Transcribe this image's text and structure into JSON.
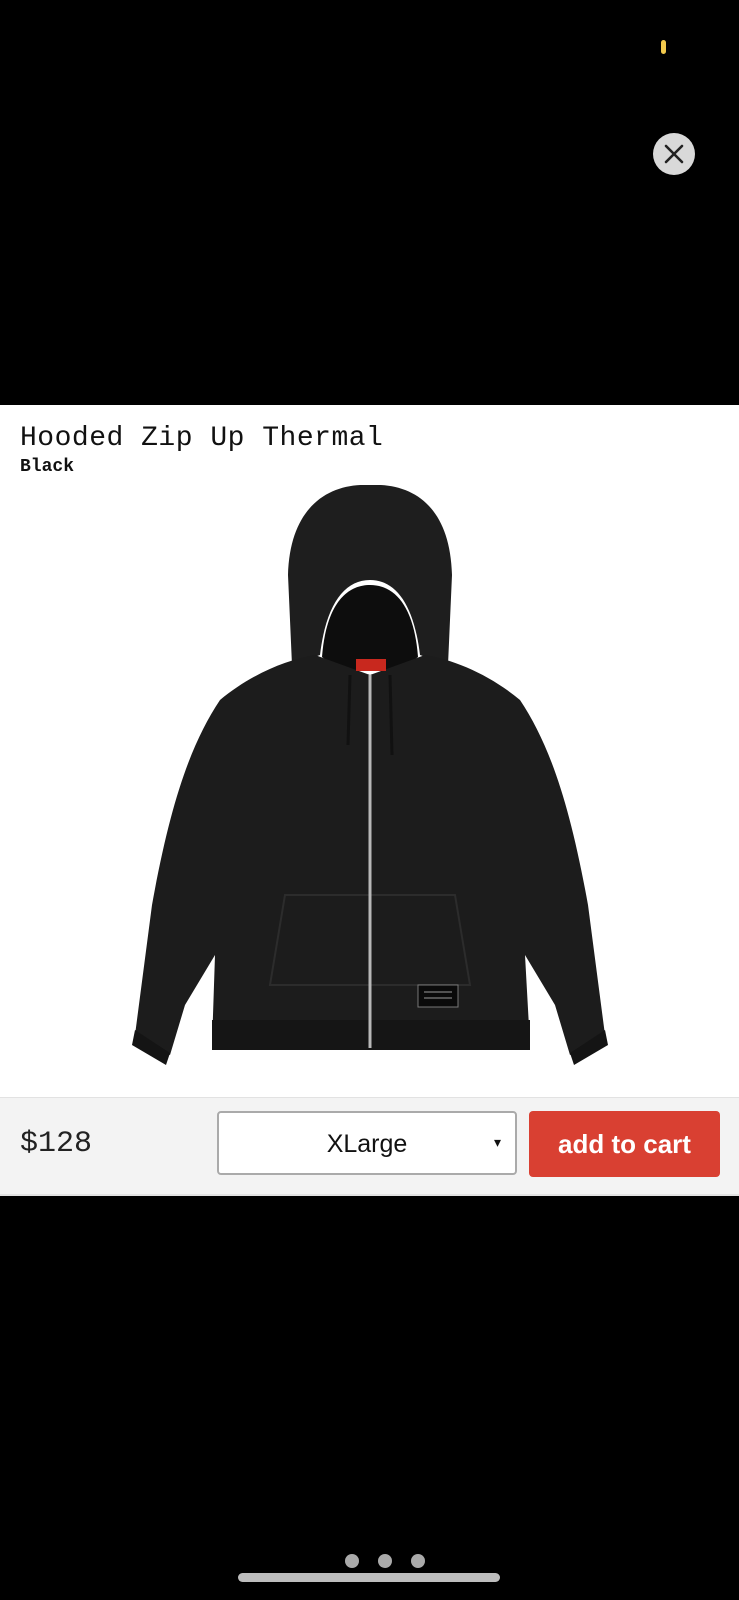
{
  "status": {
    "indicator_color": "#f2c94c"
  },
  "modal": {
    "close_icon": "close-icon"
  },
  "product": {
    "title": "Hooded Zip Up Thermal",
    "color": "Black",
    "image_description_icon": "hoodie-image",
    "price": "$128"
  },
  "size_select": {
    "selected": "XLarge",
    "caret": "▾"
  },
  "cart": {
    "label": "add to cart",
    "color": "#d94032"
  },
  "pager": {
    "count": 3
  }
}
